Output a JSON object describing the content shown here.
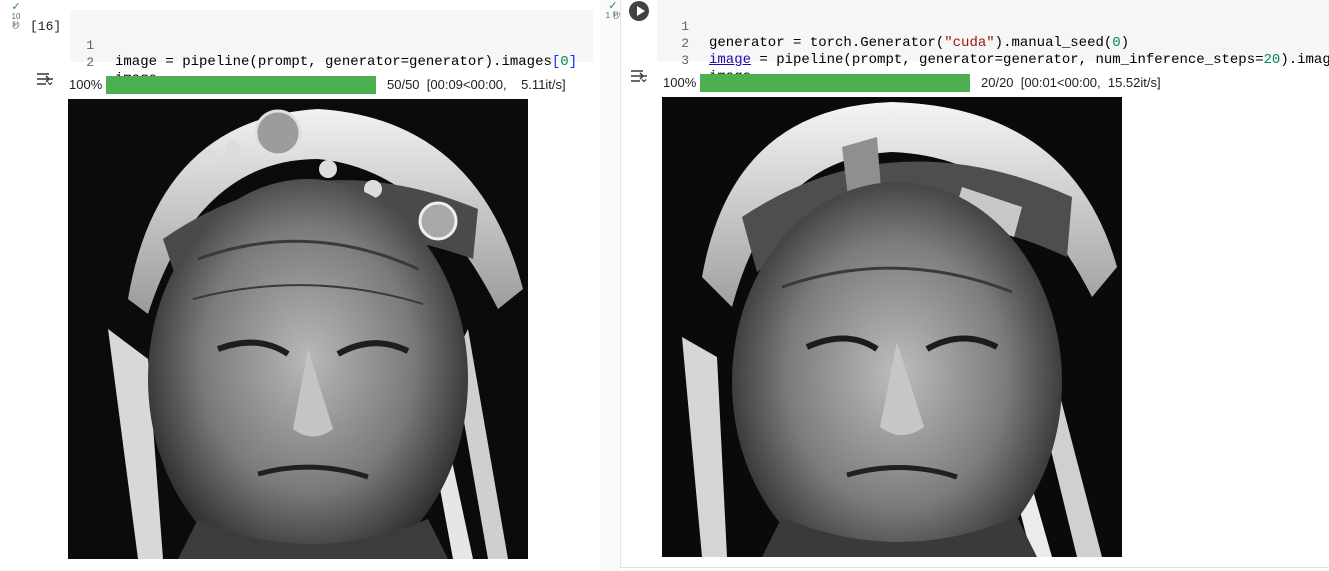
{
  "left_cell": {
    "exec_status": {
      "check": "✓",
      "time": "10",
      "unit": "秒"
    },
    "exec_count": "[16]",
    "lines": [
      {
        "num": "1"
      },
      {
        "num": "2",
        "text": "image"
      }
    ],
    "progress": {
      "percent_label": "100%",
      "fraction": 1.0,
      "stats": "50/50  [00:09<00:00,    5.11it/s]"
    },
    "image_alt": "Black and white portrait of an elderly man wearing a feathered headdress"
  },
  "right_cell": {
    "exec_status": {
      "check": "✓",
      "time": "1 秒"
    },
    "lines": [
      {
        "num": "1"
      },
      {
        "num": "2"
      },
      {
        "num": "3",
        "text": "image"
      }
    ],
    "progress": {
      "percent_label": "100%",
      "fraction": 1.0,
      "stats": "20/20  [00:01<00:00,  15.52it/s]"
    },
    "image_alt": "Black and white portrait of an elderly man wearing a feathered headdress"
  },
  "code_tokens": {
    "l1": "image = pipeline(prompt, generator=generator).images",
    "r1": [
      "generator = torch.Generator(",
      "\"cuda\"",
      ").manual_seed(",
      "0",
      ")"
    ],
    "r2": [
      "image",
      " = pipeline(prompt, generator=generator, num_inference_steps=",
      "20",
      ").images"
    ],
    "zero": "0",
    "lb": "[",
    "rb": "]"
  },
  "colors": {
    "progress_fill": "#4caf50",
    "run_button": "#424242",
    "check": "#1e8e3e"
  }
}
